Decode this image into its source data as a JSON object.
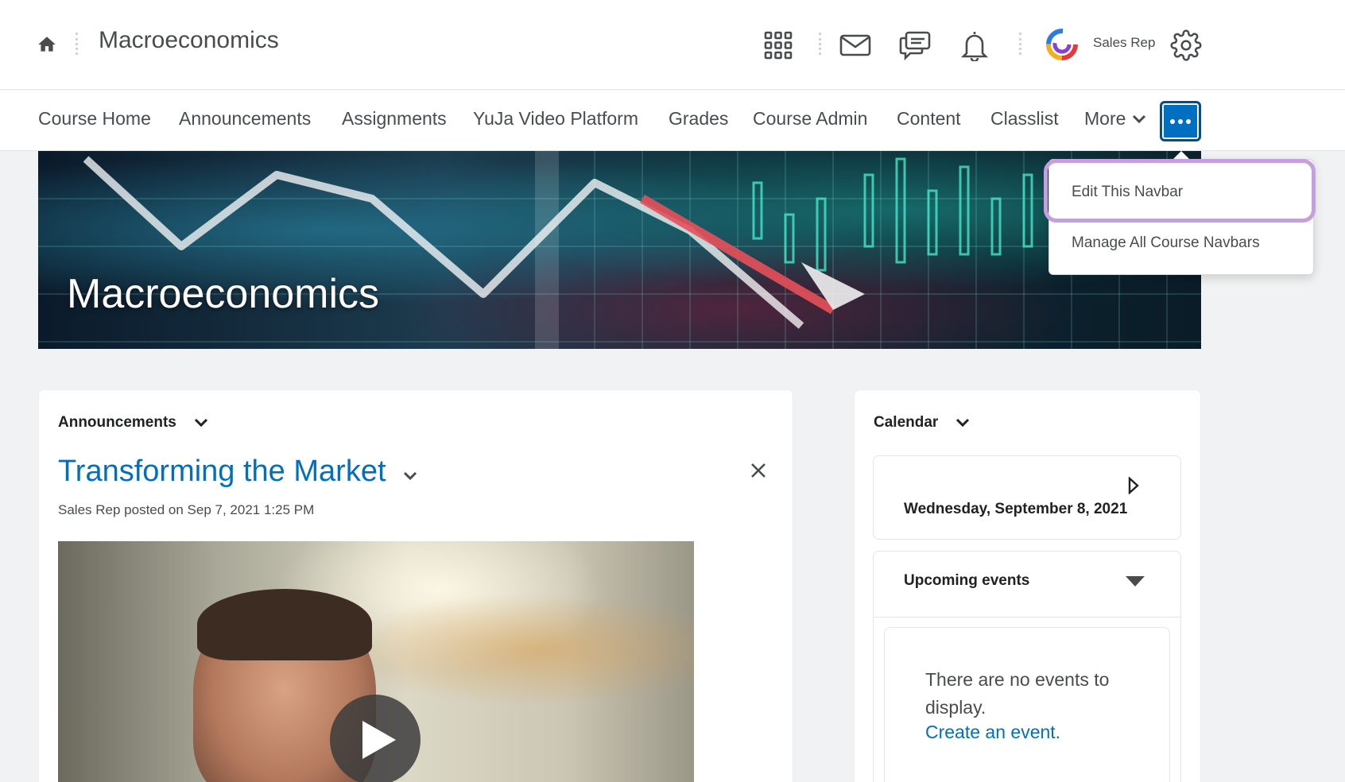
{
  "header": {
    "course_title": "Macroeconomics",
    "user_name": "Sales Rep",
    "icons": [
      "home-icon",
      "apps-grid-icon",
      "mail-icon",
      "chat-icon",
      "bell-icon",
      "avatar",
      "gear-icon"
    ]
  },
  "navbar": {
    "items": [
      {
        "label": "Course Home"
      },
      {
        "label": "Announcements"
      },
      {
        "label": "Assignments"
      },
      {
        "label": "YuJa Video Platform"
      },
      {
        "label": "Grades"
      },
      {
        "label": "Course Admin"
      },
      {
        "label": "Content"
      },
      {
        "label": "Classlist"
      }
    ],
    "more_label": "More",
    "dots_button_color": "#006fbf"
  },
  "banner": {
    "title": "Macroeconomics"
  },
  "dropdown": {
    "items": [
      {
        "label": "Edit This Navbar"
      },
      {
        "label": "Manage All Course Navbars"
      }
    ],
    "highlight_color": "#c79fe0"
  },
  "announcements": {
    "widget_title": "Announcements",
    "post_title": "Transforming the Market",
    "meta": "Sales Rep posted on Sep 7, 2021 1:25 PM"
  },
  "calendar": {
    "widget_title": "Calendar",
    "date": "Wednesday, September 8, 2021",
    "upcoming_label": "Upcoming events",
    "no_events_text": "There are no events to display.",
    "create_link": "Create an event."
  },
  "colors": {
    "link": "#006fbf",
    "text": "#494c4e",
    "background": "#f1f2f3"
  }
}
